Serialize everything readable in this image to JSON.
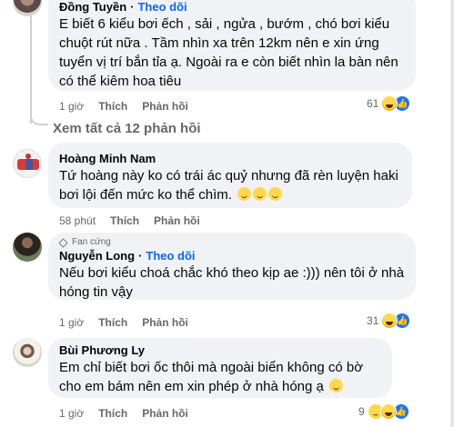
{
  "comments": [
    {
      "author": "Đồng Tuyền",
      "follow": "Theo dõi",
      "text": "E biết 6 kiểu bơi ếch , sải , ngửa , bướm , chó bơi kiểu chuột rút nữa . Tầm nhìn xa trên 12km nên e xin ứng tuyển vị trí bắn tỉa ạ. Ngoài ra e còn biết nhìn la bàn nên có thể kiêm hoa tiêu",
      "time": "1 giờ",
      "like": "Thích",
      "reply": "Phản hồi",
      "reaction_count": "61"
    },
    {
      "author": "Hoàng Minh Nam",
      "text": "Tứ hoàng này ko có trái ác quỷ nhưng đã rèn luyện haki bơi lội đến mức ko thể chìm.",
      "time": "58 phút",
      "like": "Thích",
      "reply": "Phản hồi"
    },
    {
      "badge": "Fan cứng",
      "author": "Nguyễn Long",
      "follow": "Theo dõi",
      "text": "Nếu bơi kiểu choá chắc khó theo kịp ae :))) nên tôi ở nhà hóng tin vậy",
      "time": "1 giờ",
      "like": "Thích",
      "reply": "Phản hồi",
      "reaction_count": "31"
    },
    {
      "author": "Bùi Phương Ly",
      "text": "Em chỉ biết bơi ốc thôi mà ngoài biển không có bờ cho em bám nên em xin phép ở nhà hóng ạ",
      "time": "1 giờ",
      "like": "Thích",
      "reply": "Phản hồi",
      "reaction_count": "9"
    }
  ],
  "view_all_replies": "Xem tất cả 12 phản hồi",
  "icons": {
    "haha": "haha-reaction-icon",
    "like": "like-reaction-icon",
    "sad": "sad-reaction-icon"
  },
  "colors": {
    "bubble": "#f0f2f5",
    "link": "#0866ff",
    "meta": "#65676b"
  }
}
